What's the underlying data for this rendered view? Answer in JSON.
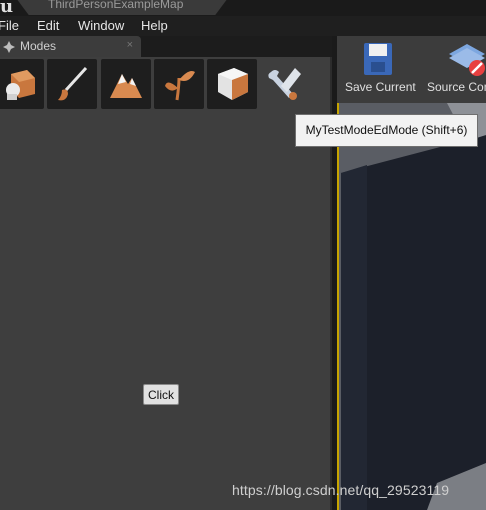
{
  "window": {
    "map_title": "ThirdPersonExampleMap"
  },
  "menubar": {
    "items": [
      "File",
      "Edit",
      "Window",
      "Help"
    ]
  },
  "modes_panel": {
    "tab_label": "Modes",
    "close_glyph": "×",
    "tools": [
      "place-icon",
      "paint-icon",
      "landscape-icon",
      "foliage-icon",
      "geometry-icon",
      "custom-mode-icon"
    ],
    "click_button_label": "Click"
  },
  "toolbar": {
    "save_label": "Save Current",
    "source_label": "Source Control"
  },
  "tooltip": {
    "text": "MyTestModeEdMode (Shift+6)"
  },
  "watermark": {
    "text": "https://blog.csdn.net/qq_29523119"
  },
  "colors": {
    "accent": "#c7a500",
    "panel": "#3e3e3e",
    "dark": "#1e1e1e"
  }
}
